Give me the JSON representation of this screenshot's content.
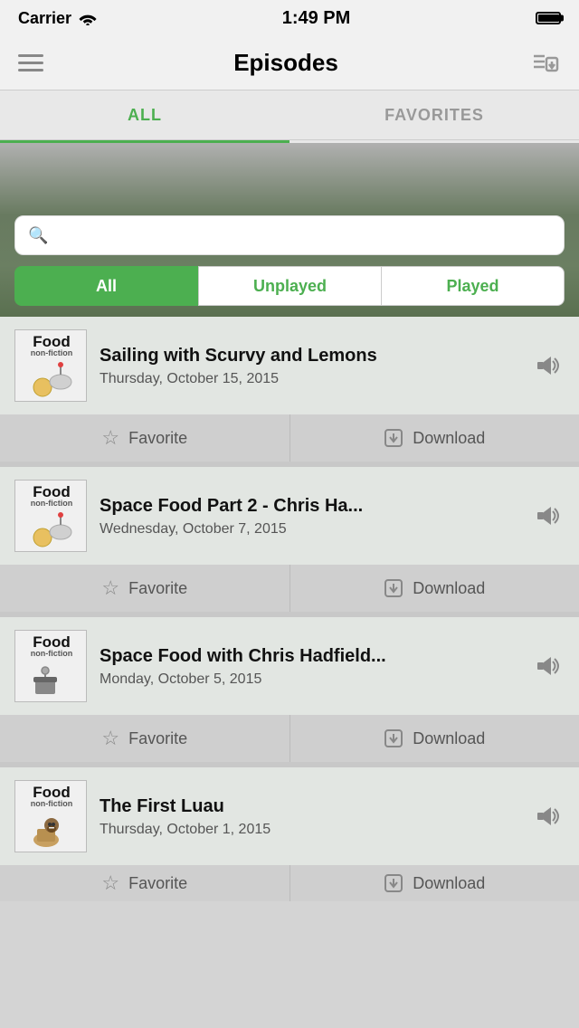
{
  "status_bar": {
    "carrier": "Carrier",
    "wifi_icon": "wifi",
    "time": "1:49 PM",
    "battery": "full"
  },
  "nav": {
    "menu_icon": "hamburger",
    "title": "Episodes",
    "download_queue_icon": "download-queue"
  },
  "tabs": [
    {
      "id": "all",
      "label": "ALL",
      "active": true
    },
    {
      "id": "favorites",
      "label": "FAVORITES",
      "active": false
    }
  ],
  "search": {
    "placeholder": ""
  },
  "filters": [
    {
      "id": "all",
      "label": "All",
      "active": true
    },
    {
      "id": "unplayed",
      "label": "Unplayed",
      "active": false
    },
    {
      "id": "played",
      "label": "Played",
      "active": false
    }
  ],
  "episodes": [
    {
      "id": 1,
      "thumb_title": "Food",
      "thumb_sub": "non-fiction",
      "title": "Sailing with Scurvy and Lemons",
      "date": "Thursday, October 15, 2015",
      "favorite_label": "Favorite",
      "download_label": "Download"
    },
    {
      "id": 2,
      "thumb_title": "Food",
      "thumb_sub": "non-fiction",
      "title": "Space Food Part 2 - Chris Ha...",
      "date": "Wednesday, October 7, 2015",
      "favorite_label": "Favorite",
      "download_label": "Download"
    },
    {
      "id": 3,
      "thumb_title": "Food",
      "thumb_sub": "non-fiction",
      "title": "Space Food with Chris Hadfield...",
      "date": "Monday, October 5, 2015",
      "favorite_label": "Favorite",
      "download_label": "Download"
    },
    {
      "id": 4,
      "thumb_title": "Food",
      "thumb_sub": "non-fiction",
      "title": "The First Luau",
      "date": "Thursday, October 1, 2015",
      "favorite_label": "Favorite",
      "download_label": "Download"
    }
  ],
  "colors": {
    "accent": "#4caf50",
    "background": "#c8c8c8",
    "card_bg": "#e0e0e0"
  }
}
